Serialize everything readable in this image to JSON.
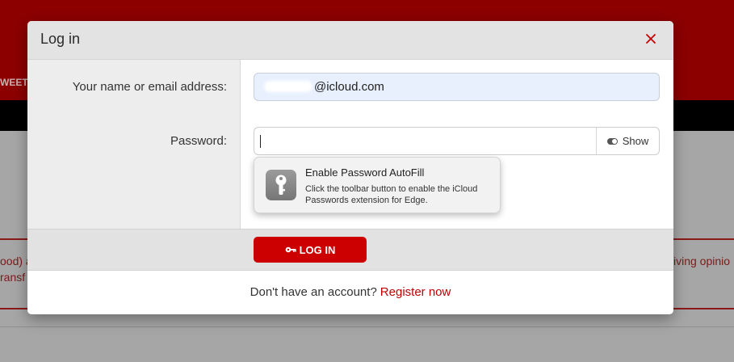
{
  "background": {
    "nav_fragment": "WEETS",
    "fragment_left_1": "ood) a",
    "fragment_left_2": "ransf",
    "fragment_right": "iving opinio"
  },
  "modal": {
    "title": "Log in",
    "close_icon": "close-icon"
  },
  "form": {
    "email_label": "Your name or email address:",
    "email_value": "@icloud.com",
    "password_label": "Password:",
    "show_label": "Show",
    "login_label": "LOG IN",
    "login_icon": "key-icon"
  },
  "autofill": {
    "title": "Enable Password AutoFill",
    "description": "Click the toolbar button to enable the iCloud Passwords extension for Edge.",
    "icon": "key-icon"
  },
  "footer": {
    "prompt": "Don't have an account?",
    "register_label": "Register now"
  },
  "colors": {
    "accent": "#cc0000",
    "header_bg": "#8c0000",
    "email_fill": "#e8f0fe"
  }
}
